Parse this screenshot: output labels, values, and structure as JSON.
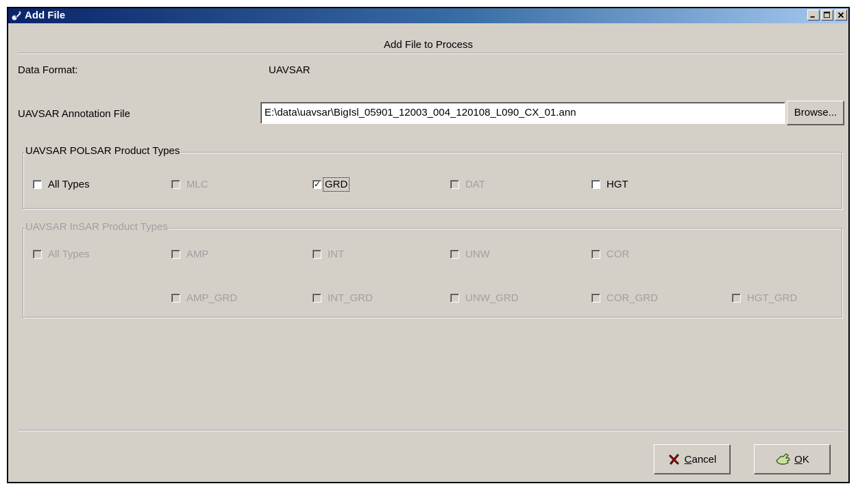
{
  "window": {
    "title": "Add File",
    "minimize": "_",
    "maximize": "□",
    "close": "×"
  },
  "heading": "Add File to Process",
  "data_format": {
    "label": "Data Format:",
    "value": "UAVSAR"
  },
  "annotation": {
    "label": "UAVSAR Annotation File",
    "value": "E:\\data\\uavsar\\BigIsl_05901_12003_004_120108_L090_CX_01.ann",
    "browse_label": "Browse..."
  },
  "polsar": {
    "title": "UAVSAR POLSAR Product Types",
    "items": [
      {
        "label": "All Types",
        "checked": false,
        "enabled": true
      },
      {
        "label": "MLC",
        "checked": false,
        "enabled": false
      },
      {
        "label": "GRD",
        "checked": true,
        "enabled": true
      },
      {
        "label": "DAT",
        "checked": false,
        "enabled": false
      },
      {
        "label": "HGT",
        "checked": false,
        "enabled": true
      }
    ]
  },
  "insar": {
    "title": "UAVSAR InSAR Product Types",
    "row1": [
      {
        "label": "All Types"
      },
      {
        "label": "AMP"
      },
      {
        "label": "INT"
      },
      {
        "label": "UNW"
      },
      {
        "label": "COR"
      }
    ],
    "row2": [
      {
        "label": "AMP_GRD"
      },
      {
        "label": "INT_GRD"
      },
      {
        "label": "UNW_GRD"
      },
      {
        "label": "COR_GRD"
      },
      {
        "label": "HGT_GRD"
      }
    ]
  },
  "buttons": {
    "cancel": {
      "label": "Cancel",
      "mnemonic": "C",
      "rest": "ancel",
      "icon": "x-cross-icon"
    },
    "ok": {
      "label": "OK",
      "mnemonic": "O",
      "rest": "K",
      "icon": "ok-hand-icon"
    }
  }
}
